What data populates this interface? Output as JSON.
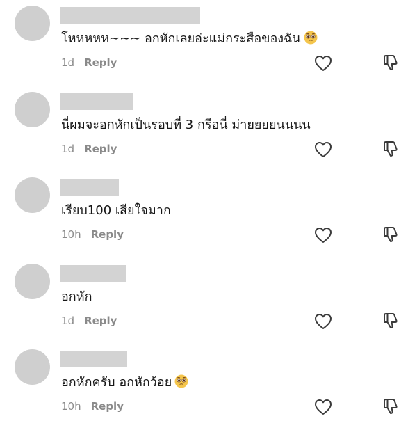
{
  "comments": [
    {
      "text": "โหหหหห~~~ อกหักเลยอ่ะแม่กระสือของฉัน",
      "emoji": "pleading-face",
      "time": "1d",
      "reply_label": "Reply"
    },
    {
      "text": "นี่ผมจะอกหักเป็นรอบที่ 3 กรีอนี่ ม่ายยยยนนนน",
      "emoji": "",
      "time": "1d",
      "reply_label": "Reply"
    },
    {
      "text": "เรียบ100 เสียใจมาก",
      "emoji": "",
      "time": "10h",
      "reply_label": "Reply"
    },
    {
      "text": "อกหัก",
      "emoji": "",
      "time": "1d",
      "reply_label": "Reply"
    },
    {
      "text": "อกหักครับ อกหักว้อย",
      "emoji": "pleading-face",
      "time": "10h",
      "reply_label": "Reply"
    }
  ],
  "icons": {
    "like": "heart-outline-icon",
    "dislike": "thumbs-down-outline-icon"
  },
  "colors": {
    "avatar_placeholder": "#cfcfcf",
    "username_placeholder": "#d3d3d3",
    "meta_text": "#8a8a8a",
    "comment_text": "#161616"
  }
}
